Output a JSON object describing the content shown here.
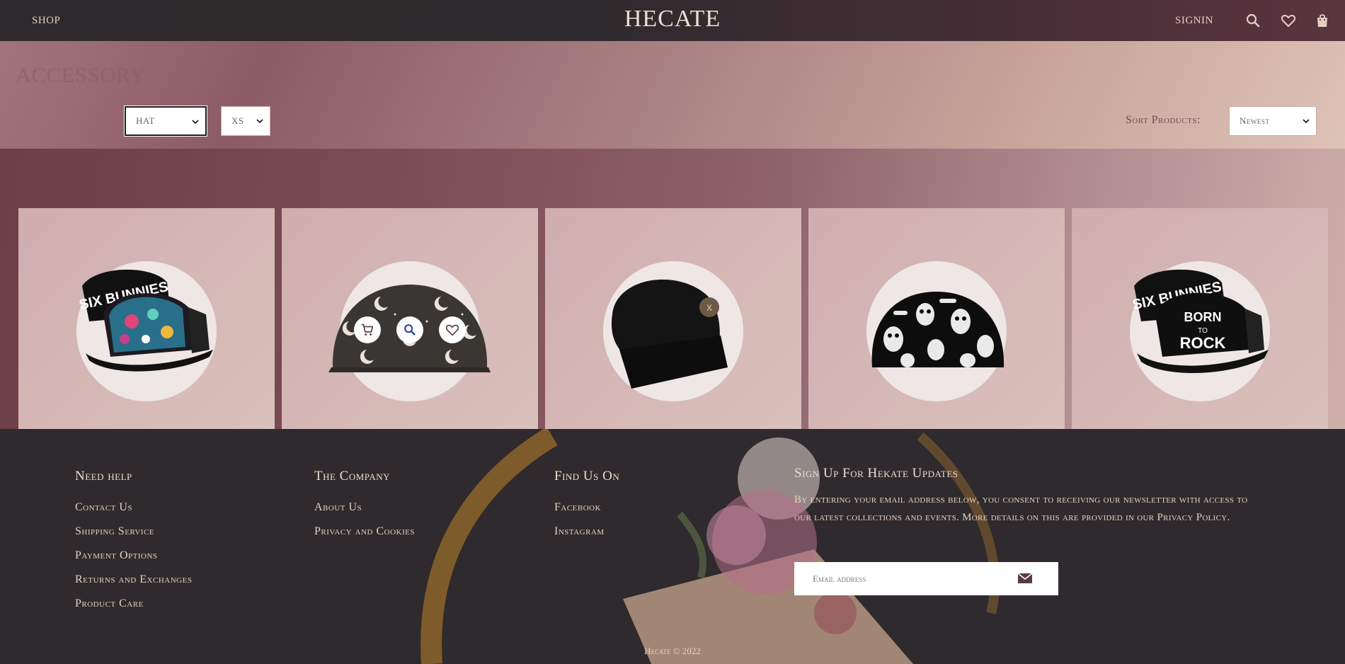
{
  "nav": {
    "shop_label": "SHOP",
    "brand": "HECATE",
    "signin_label": "SIGNIN",
    "icons": [
      "search-icon",
      "heart-icon",
      "shopping-bag-icon"
    ]
  },
  "filters": {
    "page_title": "ACCESSORY",
    "category_value": "HAT",
    "size_value": "XS",
    "sort_label": "Sort Products:",
    "sort_value": "Newest"
  },
  "products": [
    {
      "name": "six-bunnies-unicorn-cap",
      "style": "trucker-cap"
    },
    {
      "name": "moon-print-cap",
      "style": "cap",
      "hover_icons": [
        "cart-icon",
        "search-icon",
        "heart-icon"
      ]
    },
    {
      "name": "black-beanie",
      "style": "beanie"
    },
    {
      "name": "skull-print-beanie",
      "style": "beanie"
    },
    {
      "name": "six-bunnies-born-to-rock-cap",
      "style": "trucker-cap"
    }
  ],
  "footer": {
    "help": {
      "title": "Need help",
      "links": [
        "Contact Us",
        "Shipping Service",
        "Payment Options",
        "Returns and Exchanges",
        "Product Care"
      ]
    },
    "company": {
      "title": "The Company",
      "links": [
        "About Us",
        "Privacy and Cookies"
      ]
    },
    "social": {
      "title": "Find Us On",
      "links": [
        "Facebook",
        "Instagram"
      ]
    },
    "signup": {
      "title": "Sign Up For Hekate Updates",
      "text": "By entering your email address below, you consent to receiving our newsletter with access to our latest collections and events. More details on this are provided in our Privacy Policy.",
      "email_placeholder": "Email address"
    },
    "copyright": "Hecate © 2022"
  },
  "colors": {
    "nav_bg": "#2e292c",
    "accent_text": "#e8cfc2",
    "card_bg": "#d6bab6",
    "footer_bg": "#2e2a2d"
  }
}
